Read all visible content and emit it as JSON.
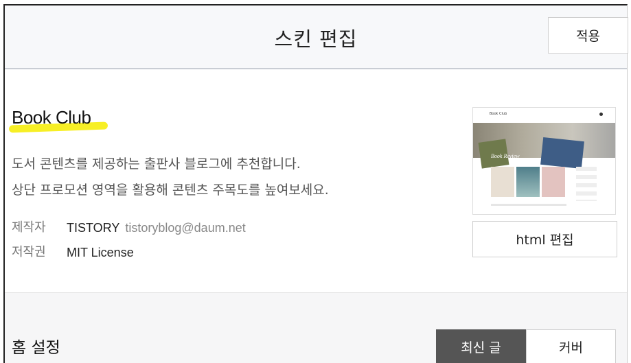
{
  "header": {
    "title": "스킨 편집",
    "apply_label": "적용"
  },
  "skin": {
    "name": "Book Club",
    "description": [
      "도서 콘텐츠를 제공하는 출판사 블로그에 추천합니다.",
      "상단 프로모션 영역을 활용해 콘텐츠 주목도를 높여보세요."
    ],
    "meta": {
      "author_label": "제작자",
      "author": "TISTORY",
      "email": "tistoryblog@daum.net",
      "license_label": "저작권",
      "license": "MIT License"
    },
    "thumbnail": {
      "logo_text": "Book Club",
      "hero_text": "Book Review"
    },
    "html_edit_label": "html 편집"
  },
  "home": {
    "title": "홈 설정",
    "tabs": [
      "최신 글",
      "커버"
    ],
    "selected_tab": "최신 글"
  },
  "colors": {
    "highlight": "#f7ef25",
    "active_tab": "#555555"
  }
}
